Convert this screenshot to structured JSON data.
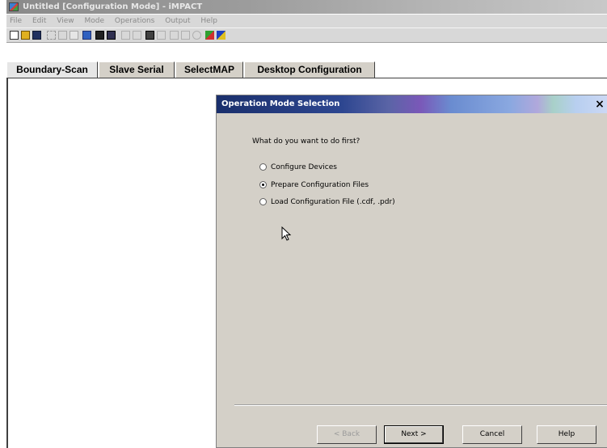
{
  "window": {
    "title": "Untitled [Configuration Mode] - iMPACT"
  },
  "menu": {
    "items": [
      "File",
      "Edit",
      "View",
      "Mode",
      "Operations",
      "Output",
      "Help"
    ]
  },
  "tabs": [
    {
      "label": "Boundary-Scan"
    },
    {
      "label": "Slave Serial"
    },
    {
      "label": "SelectMAP"
    },
    {
      "label": "Desktop Configuration"
    }
  ],
  "dialog": {
    "title": "Operation Mode Selection",
    "close_label": "×",
    "question": "What do you want to do first?",
    "options": [
      {
        "label": "Configure Devices",
        "selected": false
      },
      {
        "label": "Prepare Configuration Files",
        "selected": true
      },
      {
        "label": "Load Configuration File (.cdf, .pdr)",
        "selected": false
      }
    ],
    "buttons": {
      "back": "< Back",
      "next": "Next >",
      "cancel": "Cancel",
      "help": "Help"
    }
  },
  "colors": {
    "title_bar_start": "#1a2f6c",
    "dialog_face": "#d4d0c8"
  }
}
